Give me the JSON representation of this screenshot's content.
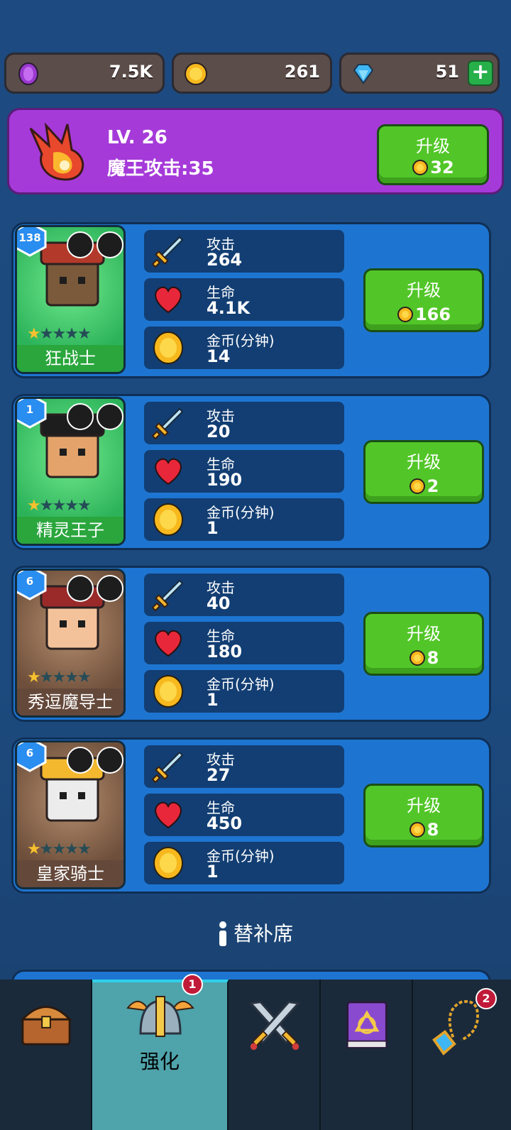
{
  "resources": {
    "purple_coins": "7.5K",
    "gold_coins": "261",
    "gems": "51",
    "gem_plus": "+"
  },
  "boss": {
    "level": "LV. 26",
    "attack": "魔王攻击:35",
    "upgrade_label": "升级",
    "upgrade_cost": "32"
  },
  "stat_labels": {
    "attack": "攻击",
    "hp": "生命",
    "gold": "金币(分钟)"
  },
  "heroes": [
    {
      "level": "138",
      "name": "狂战士",
      "stars": 1,
      "attack": "264",
      "hp": "4.1K",
      "gold": "14",
      "upgrade_label": "升级",
      "cost": "166"
    },
    {
      "level": "1",
      "name": "精灵王子",
      "stars": 1,
      "attack": "20",
      "hp": "190",
      "gold": "1",
      "upgrade_label": "升级",
      "cost": "2"
    },
    {
      "level": "6",
      "name": "秀逗魔导士",
      "stars": 1,
      "attack": "40",
      "hp": "180",
      "gold": "1",
      "upgrade_label": "升级",
      "cost": "8"
    },
    {
      "level": "6",
      "name": "皇家骑士",
      "stars": 1,
      "attack": "27",
      "hp": "450",
      "gold": "1",
      "upgrade_label": "升级",
      "cost": "8"
    }
  ],
  "bench_label": "替补席",
  "nav": {
    "items": [
      {
        "icon": "treasure-chest-icon",
        "label": ""
      },
      {
        "icon": "winged-helmet-icon",
        "label": "强化",
        "badge": "1"
      },
      {
        "icon": "crossed-swords-icon",
        "label": ""
      },
      {
        "icon": "spellbook-icon",
        "label": ""
      },
      {
        "icon": "amulet-icon",
        "label": "",
        "badge": "2"
      }
    ]
  },
  "colors": {
    "purple_banner": "#a53ad9",
    "card_blue": "#1e75d1",
    "green_button": "#52c628",
    "nav_active": "#4fa3ab"
  }
}
